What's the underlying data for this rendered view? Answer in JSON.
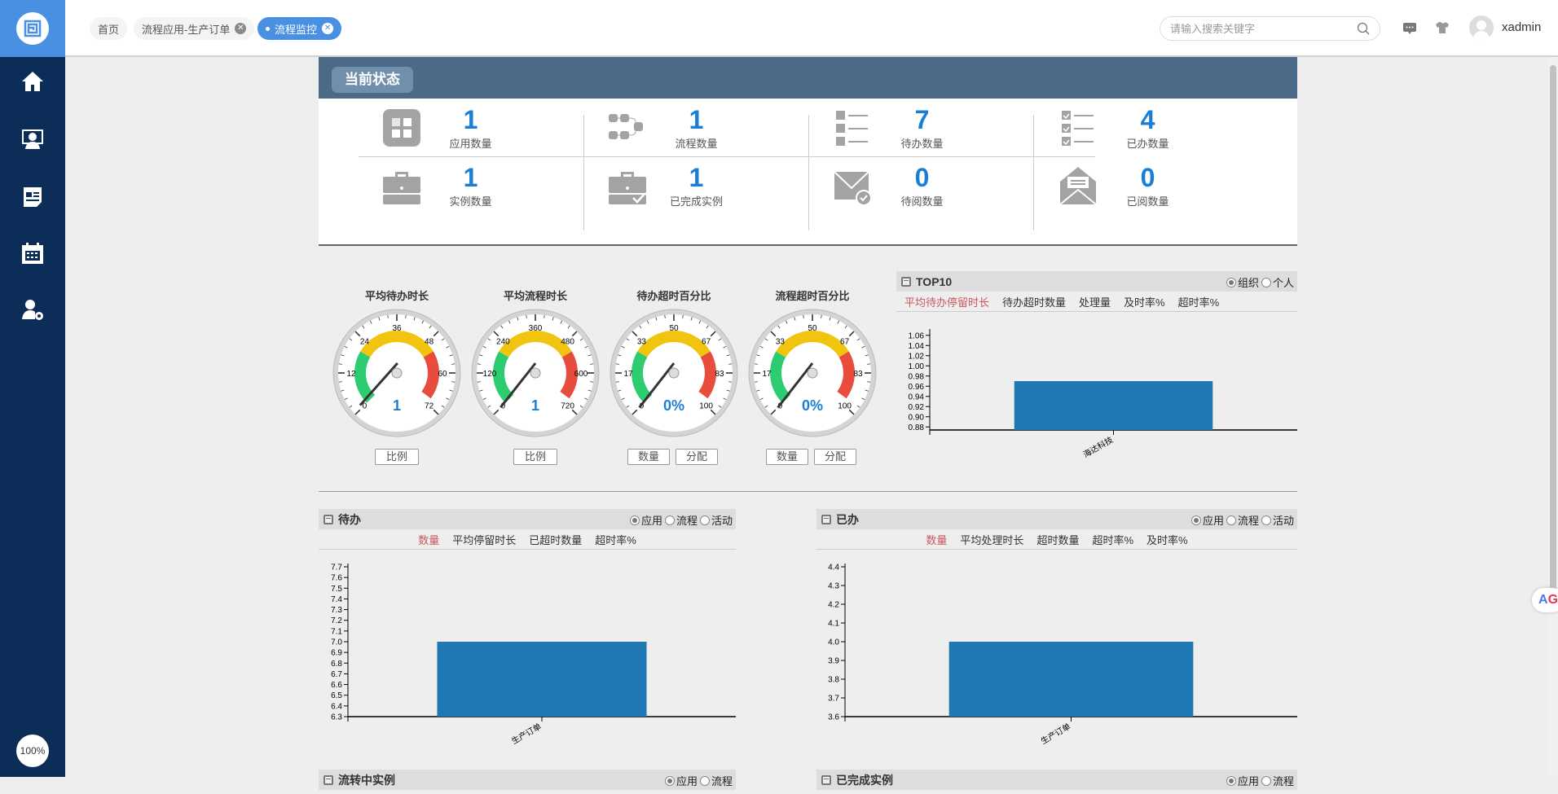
{
  "header": {
    "tabs": [
      {
        "label": "首页"
      },
      {
        "label": "流程应用-生产订单"
      },
      {
        "label": "流程监控"
      }
    ],
    "search_placeholder": "请输入搜索关键字",
    "username": "xadmin"
  },
  "sidebar": {
    "items": [
      "home",
      "monitor-user",
      "news",
      "calendar",
      "user-settings"
    ],
    "zoom": "100%"
  },
  "status": {
    "title": "当前状态",
    "stats": [
      {
        "value": "1",
        "label": "应用数量",
        "icon": "apps-grid-icon"
      },
      {
        "value": "1",
        "label": "流程数量",
        "icon": "flow-icon"
      },
      {
        "value": "7",
        "label": "待办数量",
        "icon": "todo-list-icon"
      },
      {
        "value": "4",
        "label": "已办数量",
        "icon": "done-list-icon"
      },
      {
        "value": "1",
        "label": "实例数量",
        "icon": "briefcase-icon"
      },
      {
        "value": "1",
        "label": "已完成实例",
        "icon": "briefcase-check-icon"
      },
      {
        "value": "0",
        "label": "待阅数量",
        "icon": "mail-check-icon"
      },
      {
        "value": "0",
        "label": "已阅数量",
        "icon": "mail-open-icon"
      }
    ]
  },
  "gauges": [
    {
      "title": "平均待办时长",
      "ticks": [
        "0",
        "12",
        "24",
        "36",
        "48",
        "60",
        "72"
      ],
      "value": 1,
      "max": 72,
      "display": "1",
      "buttons": [
        "比例"
      ]
    },
    {
      "title": "平均流程时长",
      "ticks": [
        "0",
        "120",
        "240",
        "360",
        "480",
        "600",
        "720"
      ],
      "value": 1,
      "max": 720,
      "display": "1",
      "buttons": [
        "比例"
      ]
    },
    {
      "title": "待办超时百分比",
      "ticks": [
        "0",
        "17",
        "33",
        "50",
        "67",
        "83",
        "100"
      ],
      "value": 0,
      "max": 100,
      "display": "0%",
      "buttons": [
        "数量",
        "分配"
      ]
    },
    {
      "title": "流程超时百分比",
      "ticks": [
        "0",
        "17",
        "33",
        "50",
        "67",
        "83",
        "100"
      ],
      "value": 0,
      "max": 100,
      "display": "0%",
      "buttons": [
        "数量",
        "分配"
      ]
    }
  ],
  "panels": {
    "top10": {
      "title": "TOP10",
      "radios": [
        "组织",
        "个人"
      ],
      "tabs": [
        "平均待办停留时长",
        "待办超时数量",
        "处理量",
        "及时率%",
        "超时率%"
      ]
    },
    "todo": {
      "title": "待办",
      "radios": [
        "应用",
        "流程",
        "活动"
      ],
      "tabs": [
        "数量",
        "平均停留时长",
        "已超时数量",
        "超时率%"
      ]
    },
    "done": {
      "title": "已办",
      "radios": [
        "应用",
        "流程",
        "活动"
      ],
      "tabs": [
        "数量",
        "平均处理时长",
        "超时数量",
        "超时率%",
        "及时率%"
      ]
    },
    "bottom_left": {
      "title": "流转中实例",
      "radios": [
        "应用",
        "流程"
      ]
    },
    "bottom_right": {
      "title": "已完成实例",
      "radios": [
        "应用",
        "流程"
      ]
    }
  },
  "chart_data": [
    {
      "type": "bar",
      "title": "TOP10",
      "categories": [
        "海达科技"
      ],
      "values": [
        0.97
      ],
      "ylim": [
        0.874,
        1.066
      ],
      "yticks": [
        "0.88",
        "0.90",
        "0.92",
        "0.94",
        "0.96",
        "0.98",
        "1.00",
        "1.02",
        "1.04",
        "1.06"
      ],
      "color": "#1f77b4"
    },
    {
      "type": "bar",
      "title": "待办",
      "categories": [
        "生产订单"
      ],
      "values": [
        7
      ],
      "ylim": [
        6.3,
        7.7
      ],
      "yticks": [
        "6.3",
        "6.4",
        "6.5",
        "6.6",
        "6.7",
        "6.8",
        "6.9",
        "7.0",
        "7.1",
        "7.2",
        "7.3",
        "7.4",
        "7.5",
        "7.6",
        "7.7"
      ],
      "color": "#1f77b4"
    },
    {
      "type": "bar",
      "title": "已办",
      "categories": [
        "生产订单"
      ],
      "values": [
        4
      ],
      "ylim": [
        3.6,
        4.4
      ],
      "yticks": [
        "3.6",
        "3.7",
        "3.8",
        "3.9",
        "4.0",
        "4.1",
        "4.2",
        "4.3",
        "4.4"
      ],
      "color": "#1f77b4"
    }
  ],
  "colors": {
    "accent": "#4a90e2",
    "sidebar": "#0b2d57",
    "number": "#1a7fd4",
    "green": "#2ecc71",
    "yellow": "#f1c40f",
    "red": "#e74c3c"
  }
}
